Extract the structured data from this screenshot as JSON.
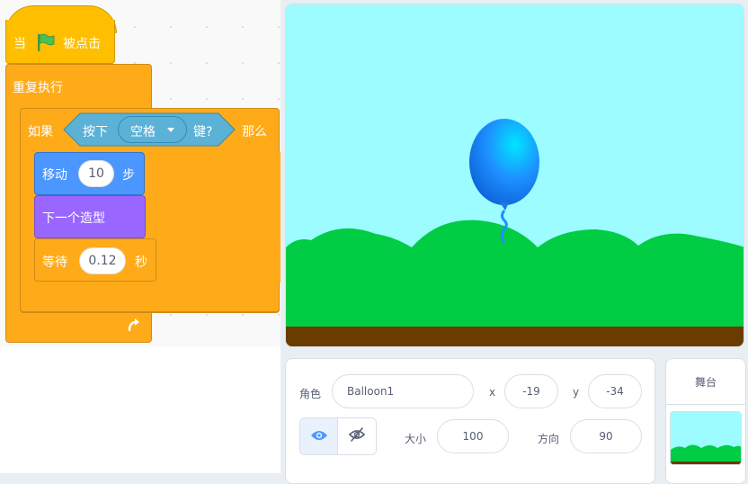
{
  "code": {
    "hat": {
      "prefix": "当",
      "suffix": "被点击",
      "flag_icon": "green-flag-icon"
    },
    "forever": {
      "label": "重复执行",
      "loop_icon": "loop-arrow-icon"
    },
    "if_block": {
      "prefix": "如果",
      "sensing_prefix": "按下",
      "key_dropdown": "空格",
      "sensing_suffix": "键?",
      "suffix": "那么"
    },
    "move": {
      "label": "移动",
      "steps": "10",
      "unit": "步"
    },
    "next_costume": {
      "label": "下一个造型"
    },
    "wait": {
      "label": "等待",
      "seconds": "0.12",
      "unit": "秒"
    }
  },
  "stage": {
    "sprite_name": "Balloon1",
    "colors": {
      "sky": "#9cfcff",
      "hills": "#00cc44",
      "ground": "#6a3c00",
      "balloon": "#1e90ff"
    }
  },
  "sprite_info": {
    "sprite_label": "角色",
    "sprite_name": "Balloon1",
    "x_label": "x",
    "x_value": "-19",
    "y_label": "y",
    "y_value": "-34",
    "show_icon": "eye-icon",
    "hide_icon": "eye-slash-icon",
    "size_label": "大小",
    "size_value": "100",
    "direction_label": "方向",
    "direction_value": "90"
  },
  "stage_panel": {
    "label": "舞台"
  },
  "colors": {
    "events": "#ffbf00",
    "control": "#ffab19",
    "motion": "#4c97ff",
    "looks": "#9966ff",
    "sensing": "#5cb1d6",
    "selected_blue": "#4c97ff"
  }
}
